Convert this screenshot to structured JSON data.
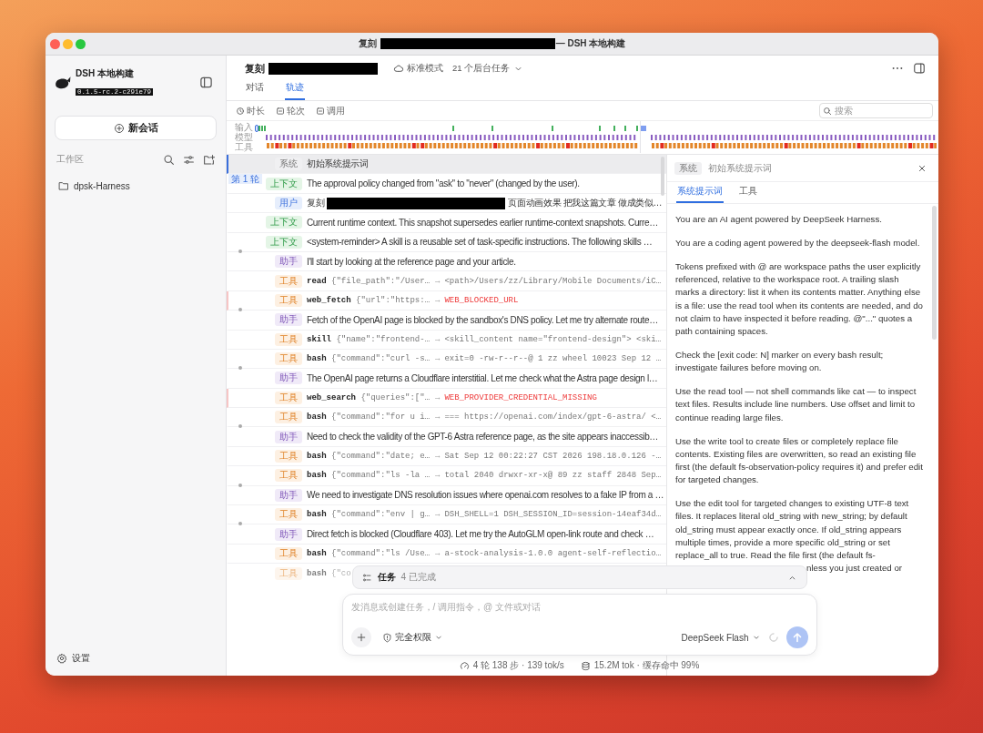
{
  "window": {
    "title": "复刻",
    "title_redacted": true,
    "title_suffix": "— DSH 本地构建"
  },
  "sidebar": {
    "app_name": "DSH 本地构建",
    "version": "0.1.5-rc.2-c291e79",
    "new_chat_button": "新会话",
    "workspace_label": "工作区",
    "items": [
      {
        "label": "dpsk-Harness"
      }
    ],
    "settings": "设置"
  },
  "header": {
    "title": "复刻",
    "title_redacted": true,
    "mode": "标准模式",
    "background_tasks": "21 个后台任务"
  },
  "tabs": [
    {
      "label": "对话",
      "selected": false
    },
    {
      "label": "轨迹",
      "selected": true
    }
  ],
  "filters": [
    {
      "label": "时长",
      "kind": "clock"
    },
    {
      "label": "轮次",
      "kind": "group"
    },
    {
      "label": "调用",
      "kind": "group"
    }
  ],
  "search": {
    "placeholder": "搜索"
  },
  "timeline": {
    "lanes": [
      {
        "label": "输入"
      },
      {
        "label": "模型"
      },
      {
        "label": "工具"
      }
    ]
  },
  "trace_rows": [
    {
      "kind": "system",
      "role": "系统",
      "text": "初始系统提示词",
      "selected": true,
      "dot": false,
      "faded": false
    },
    {
      "kind": "context",
      "role": "上下文",
      "text": "The approval policy changed from \"ask\" to \"never\" (changed by the user).",
      "turn_label": "第 1 轮",
      "selected": false,
      "dot": false,
      "faded": false
    },
    {
      "kind": "user",
      "role": "用户",
      "text": "复刻",
      "redacted": true,
      "text_after": "页面动画效果 把我这篇文章 做成类似…",
      "selected": false,
      "dot": false,
      "faded": false
    },
    {
      "kind": "context",
      "role": "上下文",
      "text": "Current runtime context. This snapshot supersedes earlier runtime-context snapshots. Curre…",
      "selected": false,
      "dot": false,
      "faded": false
    },
    {
      "kind": "context",
      "role": "上下文",
      "text": "<system-reminder> A skill is a reusable set of task-specific instructions. The following skills …",
      "selected": false,
      "dot": false,
      "faded": false
    },
    {
      "kind": "assistant",
      "role": "助手",
      "text": "I'll start by looking at the reference page and your article.",
      "selected": false,
      "dot": true,
      "faded": false
    },
    {
      "kind": "tool",
      "role": "工具",
      "name": "read",
      "args": "{\"file_path\":\"/User…",
      "sep": "→",
      "result": "<path>/Users/zz/Library/Mobile Documents/iC…",
      "error": false,
      "selected": false,
      "dot": false,
      "faded": false
    },
    {
      "kind": "tool",
      "role": "工具",
      "name": "web_fetch",
      "args": "{\"url\":\"https:…",
      "sep": "→",
      "result": "WEB_BLOCKED_URL",
      "error": true,
      "selected": false,
      "dot": false,
      "faded": false
    },
    {
      "kind": "assistant",
      "role": "助手",
      "text": "Fetch of the OpenAI page is blocked by the sandbox's DNS policy. Let me try alternate route…",
      "selected": false,
      "dot": true,
      "faded": false
    },
    {
      "kind": "tool",
      "role": "工具",
      "name": "skill",
      "args": "{\"name\":\"frontend-…",
      "sep": "→",
      "result": "<skill_content name=\"frontend-design\"> <ski…",
      "error": false,
      "selected": false,
      "dot": false,
      "faded": false
    },
    {
      "kind": "tool",
      "role": "工具",
      "name": "bash",
      "args": "{\"command\":\"curl -s…",
      "sep": "→",
      "result": "exit=0 -rw-r--r--@ 1 zz wheel 10023 Sep 12 …",
      "error": false,
      "selected": false,
      "dot": false,
      "faded": false
    },
    {
      "kind": "assistant",
      "role": "助手",
      "text": "The OpenAI page returns a Cloudflare interstitial. Let me check what the Astra page design l…",
      "selected": false,
      "dot": true,
      "faded": false
    },
    {
      "kind": "tool",
      "role": "工具",
      "name": "web_search",
      "args": "{\"queries\":[\"…",
      "sep": "→",
      "result": "WEB_PROVIDER_CREDENTIAL_MISSING",
      "error": true,
      "selected": false,
      "dot": false,
      "faded": false
    },
    {
      "kind": "tool",
      "role": "工具",
      "name": "bash",
      "args": "{\"command\":\"for u i…",
      "sep": "→",
      "result": "=== https://openai.com/index/gpt-6-astra/ <…",
      "error": false,
      "selected": false,
      "dot": false,
      "faded": false
    },
    {
      "kind": "assistant",
      "role": "助手",
      "text": "Need to check the validity of the GPT-6 Astra reference page, as the site appears inaccessib…",
      "selected": false,
      "dot": true,
      "faded": false
    },
    {
      "kind": "tool",
      "role": "工具",
      "name": "bash",
      "args": "{\"command\":\"date; e…",
      "sep": "→",
      "result": "Sat Sep 12 00:22:27 CST 2026 198.18.0.126 -…",
      "error": false,
      "selected": false,
      "dot": false,
      "faded": false
    },
    {
      "kind": "tool",
      "role": "工具",
      "name": "bash",
      "args": "{\"command\":\"ls -la …",
      "sep": "→",
      "result": "total 2040 drwxr-xr-x@ 89 zz staff 2848 Sep…",
      "error": false,
      "selected": false,
      "dot": false,
      "faded": false
    },
    {
      "kind": "assistant",
      "role": "助手",
      "text": "We need to investigate DNS resolution issues where openai.com resolves to a fake IP from a …",
      "selected": false,
      "dot": true,
      "faded": false
    },
    {
      "kind": "tool",
      "role": "工具",
      "name": "bash",
      "args": "{\"command\":\"env | g…",
      "sep": "→",
      "result": "DSH_SHELL=1 DSH_SESSION_ID=session-14eaf34d…",
      "error": false,
      "selected": false,
      "dot": false,
      "faded": false
    },
    {
      "kind": "assistant",
      "role": "助手",
      "text": "Direct fetch is blocked (Cloudflare 403). Let me try the AutoGLM open-link route and check …",
      "selected": false,
      "dot": true,
      "faded": false
    },
    {
      "kind": "tool",
      "role": "工具",
      "name": "bash",
      "args": "{\"command\":\"ls /Use…",
      "sep": "→",
      "result": "a-stock-analysis-1.0.0 agent-self-reflectio…",
      "error": false,
      "selected": false,
      "dot": false,
      "faded": false
    },
    {
      "kind": "tool",
      "role": "工具",
      "name": "bash",
      "args": "{\"co",
      "error": false,
      "selected": false,
      "dot": false,
      "faded": true
    }
  ],
  "detail": {
    "role": "系统",
    "title": "初始系统提示词",
    "tabs": [
      {
        "label": "系统提示词",
        "selected": true
      },
      {
        "label": "工具",
        "selected": false
      }
    ],
    "paragraphs": [
      "You are an AI agent powered by DeepSeek Harness.",
      "You are a coding agent powered by the deepseek-flash model.",
      "Tokens prefixed with @ are workspace paths the user explicitly referenced, relative to the workspace root. A trailing slash marks a directory: list it when its contents matter. Anything else is a file: use the read tool when its contents are needed, and do not claim to have inspected it before reading. @\"...\" quotes a path containing spaces.",
      "Check the [exit code: N] marker on every bash result; investigate failures before moving on.",
      "Use the read tool — not shell commands like cat — to inspect text files. Results include line numbers. Use offset and limit to continue reading large files.",
      "Use the write tool to create files or completely replace file contents. Existing files are overwritten, so read an existing file first (the default fs-observation-policy requires it) and prefer edit for targeted changes.",
      "Use the edit tool for targeted changes to existing UTF-8 text files. It replaces literal old_string with new_string; by default old_string must appear exactly once. If old_string appears multiple times, provide a more specific old_string or set replace_all to true. Read the file first (the default fs-"
    ],
    "partial_line": "nless you just created or"
  },
  "tasks": {
    "label": "任务",
    "count": "4 已完成"
  },
  "composer": {
    "placeholder": "发消息或创建任务，/ 调用指令，@ 文件或对话",
    "permission": "完全权限",
    "model": "DeepSeek Flash"
  },
  "status": {
    "steps": "4 轮 138 步 · 139 tok/s",
    "tokens": "15.2M tok · 缓存命中 99%"
  }
}
